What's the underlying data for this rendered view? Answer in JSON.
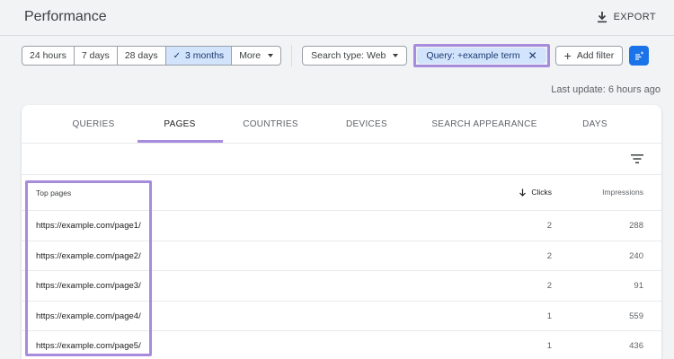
{
  "header": {
    "title": "Performance",
    "export_label": "EXPORT"
  },
  "date_range": {
    "options": [
      "24 hours",
      "7 days",
      "28 days",
      "3 months",
      "More"
    ],
    "selected": "3 months"
  },
  "filters": {
    "search_type_label": "Search type: Web",
    "query_chip_label": "Query: +example term",
    "add_filter_label": "Add filter"
  },
  "last_update": "Last update: 6 hours ago",
  "tabs": [
    "QUERIES",
    "PAGES",
    "COUNTRIES",
    "DEVICES",
    "SEARCH APPEARANCE",
    "DAYS"
  ],
  "active_tab": "PAGES",
  "table": {
    "headers": {
      "page": "Top pages",
      "clicks": "Clicks",
      "impressions": "Impressions"
    },
    "rows": [
      {
        "url": "https://example.com/page1/",
        "clicks": "2",
        "impressions": "288"
      },
      {
        "url": "https://example.com/page2/",
        "clicks": "2",
        "impressions": "240"
      },
      {
        "url": "https://example.com/page3/",
        "clicks": "2",
        "impressions": "91"
      },
      {
        "url": "https://example.com/page4/",
        "clicks": "1",
        "impressions": "559"
      },
      {
        "url": "https://example.com/page5/",
        "clicks": "1",
        "impressions": "436"
      }
    ]
  },
  "colors": {
    "accent": "#1a73e8",
    "selected_bg": "#d2e3fc",
    "highlight": "#a78bdc"
  }
}
